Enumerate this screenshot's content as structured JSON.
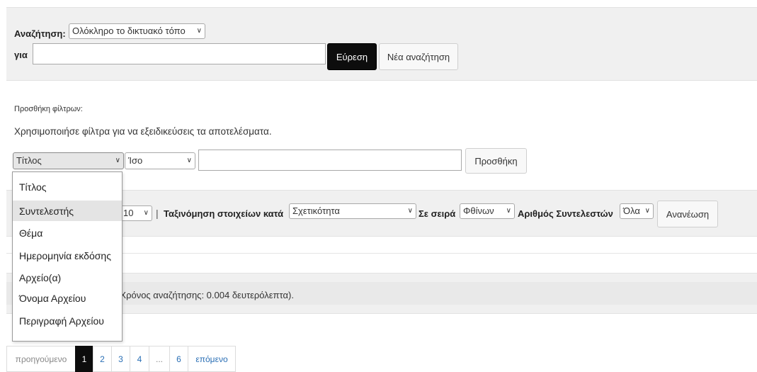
{
  "search": {
    "scope_label": "Αναζήτηση:",
    "scope_value": "Ολόκληρο το δικτυακό τόπο",
    "for_label": "για",
    "query_value": "",
    "find_button": "Εύρεση",
    "new_search_button": "Νέα αναζήτηση"
  },
  "filters": {
    "heading": "Προσθήκη φίλτρων:",
    "help_text": "Χρησιμοποιήσε φίλτρα για να εξειδικεύσεις τα αποτελέσματα.",
    "field_value": "Τίτλος",
    "operator_value": "Ίσο",
    "filter_value": "",
    "add_button": "Προσθήκη",
    "field_options": [
      "Τίτλος",
      "Συντελεστής",
      "Θέμα",
      "Ημερομηνία εκδόσης",
      "Αρχείο(α)",
      "Όνομα Αρχείου",
      "Περιγραφή Αρχείου"
    ],
    "highlighted_option": "Συντελεστής"
  },
  "sort": {
    "rpp_value": "10",
    "separator": "|",
    "sort_label": "Ταξινόμηση στοιχείων κατά",
    "sort_value": "Σχετικότητα",
    "order_label": "Σε σειρά",
    "order_value": "Φθίνων",
    "authors_label": "Αριθμός Συντελεστών",
    "authors_value": "Όλα",
    "refresh_button": "Ανανέωση"
  },
  "results": {
    "summary_visible": "57 (Χρόνος αναζήτησης: 0.004 δευτερόλεπτα)."
  },
  "pagination": {
    "prev": "προηγούμενο",
    "pages": [
      "1",
      "2",
      "3",
      "4",
      "...",
      "6"
    ],
    "current": "1",
    "next": "επόμενο"
  },
  "colors": {
    "panel_bg": "#f0f0f0",
    "dark_button": "#0d0d0d",
    "link": "#2a6fb5"
  }
}
